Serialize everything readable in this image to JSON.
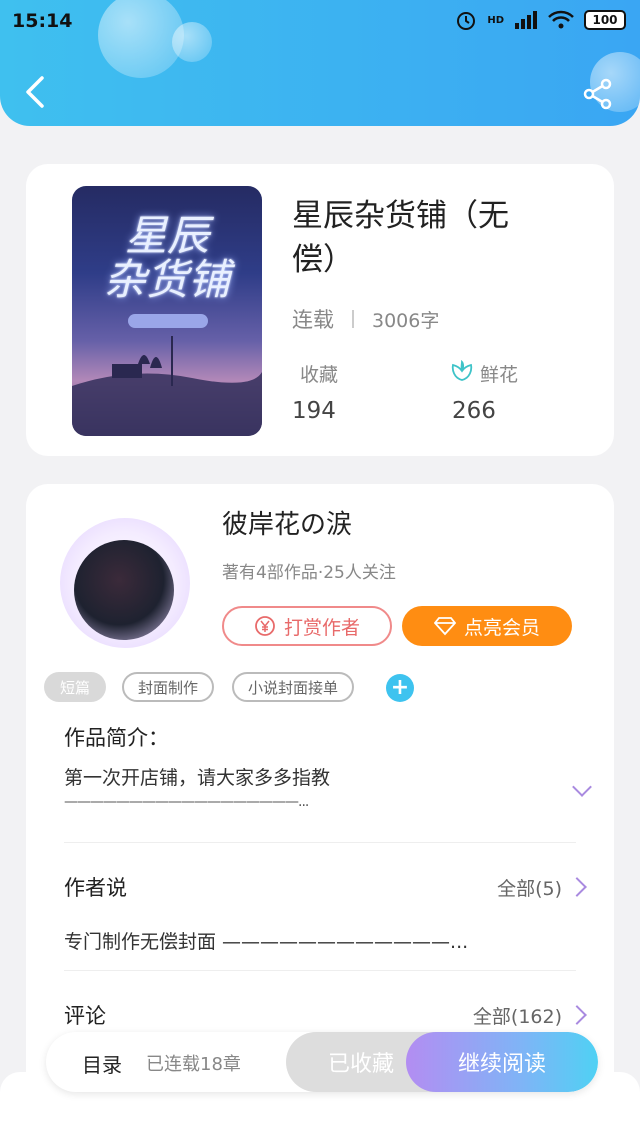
{
  "status": {
    "time": "15:14",
    "battery": "100",
    "network": "HD"
  },
  "book": {
    "title": "星辰杂货铺（无偿）",
    "status": "连载",
    "word_count": "3006字",
    "favorites_label": "收藏",
    "favorites_value": "194",
    "flowers_label": "鲜花",
    "flowers_value": "266",
    "cover_title": "星辰杂货铺"
  },
  "author": {
    "name": "彼岸花の涙",
    "sub": "著有4部作品·25人关注",
    "reward_label": "打赏作者",
    "vip_label": "点亮会员"
  },
  "tags": [
    "短篇",
    "封面制作",
    "小说封面接单"
  ],
  "intro": {
    "title": "作品简介：",
    "line1": "第一次开店铺，请大家多多指教",
    "line2": "——————————————————..."
  },
  "author_says": {
    "title": "作者说",
    "more": "全部(5)",
    "text": "专门制作无偿封面 ————————————..."
  },
  "comments": {
    "title": "评论",
    "more": "全部(162)"
  },
  "bottom": {
    "toc_label": "目录",
    "chapters_label": "已连载18章",
    "fav_label": "已收藏",
    "read_label": "继续阅读"
  },
  "colors": {
    "accent": "#3fb6f0",
    "vip": "#ff8d12",
    "reward": "#e86a6a"
  }
}
